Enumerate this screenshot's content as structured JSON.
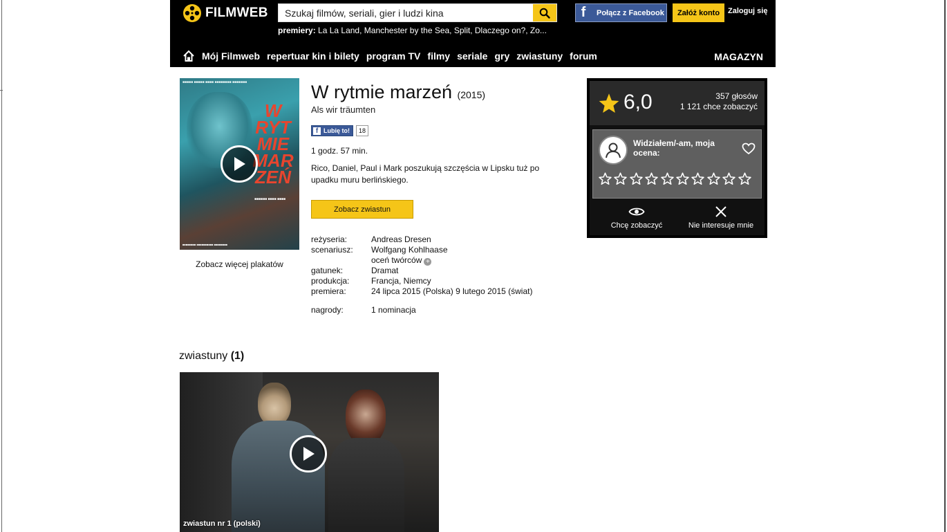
{
  "header": {
    "logo_text": "FILMWEB",
    "search_placeholder": "Szukaj filmów, seriali, gier i ludzi kina",
    "premiery_label": "premiery:",
    "premiery_list": "La La Land, Manchester by the Sea, Split, Dlaczego on?, Zo...",
    "facebook_button": "Połącz z Facebook",
    "register_button": "Załóż konto",
    "login_link": "Zaloguj się",
    "nav": [
      "Mój Filmweb",
      "repertuar kin i bilety",
      "program TV",
      "filmy",
      "seriale",
      "gry",
      "zwiastuny",
      "forum"
    ],
    "magazine": "MAGAZYN"
  },
  "poster": {
    "title_art": "W RYT MIE MAR ZEŃ",
    "more_posters": "Zobacz więcej plakatów"
  },
  "film": {
    "title": "W rytmie marzeń",
    "year": "(2015)",
    "original_title": "Als wir träumten",
    "like_label": "Lubię to!",
    "like_count": "18",
    "duration": "1 godz. 57 min.",
    "description": "Rico, Daniel, Paul i Mark poszukują szczęścia w Lipsku tuż po upadku muru berlińskiego.",
    "trailer_button": "Zobacz zwiastun",
    "details": {
      "director_label": "reżyseria:",
      "director": "Andreas Dresen",
      "writer_label": "scenariusz:",
      "writer": "Wolfgang Kohlhaase",
      "rate_creators": "oceń twórców",
      "genre_label": "gatunek:",
      "genre": "Dramat",
      "production_label": "produkcja:",
      "production": "Francja, Niemcy",
      "premiere_label": "premiera:",
      "premiere": "24 lipca 2015 (Polska) 9 lutego 2015 (świat)",
      "awards_label": "nagrody:",
      "awards": "1 nominacja"
    }
  },
  "rating": {
    "value": "6,0",
    "votes": "357 głosów",
    "want_count": "1 121 chce zobaczyć",
    "seen_text": "Widziałem/-am, moja ocena:",
    "stars_count": 10,
    "want_label": "Chcę zobaczyć",
    "not_interested_label": "Nie interesuje mnie"
  },
  "trailers": {
    "heading": "zwiastuny",
    "count": "(1)",
    "caption": "zwiastun nr 1 (polski)"
  },
  "colors": {
    "accent": "#f5c518",
    "facebook": "#3b5998",
    "header_bg": "#000000"
  }
}
